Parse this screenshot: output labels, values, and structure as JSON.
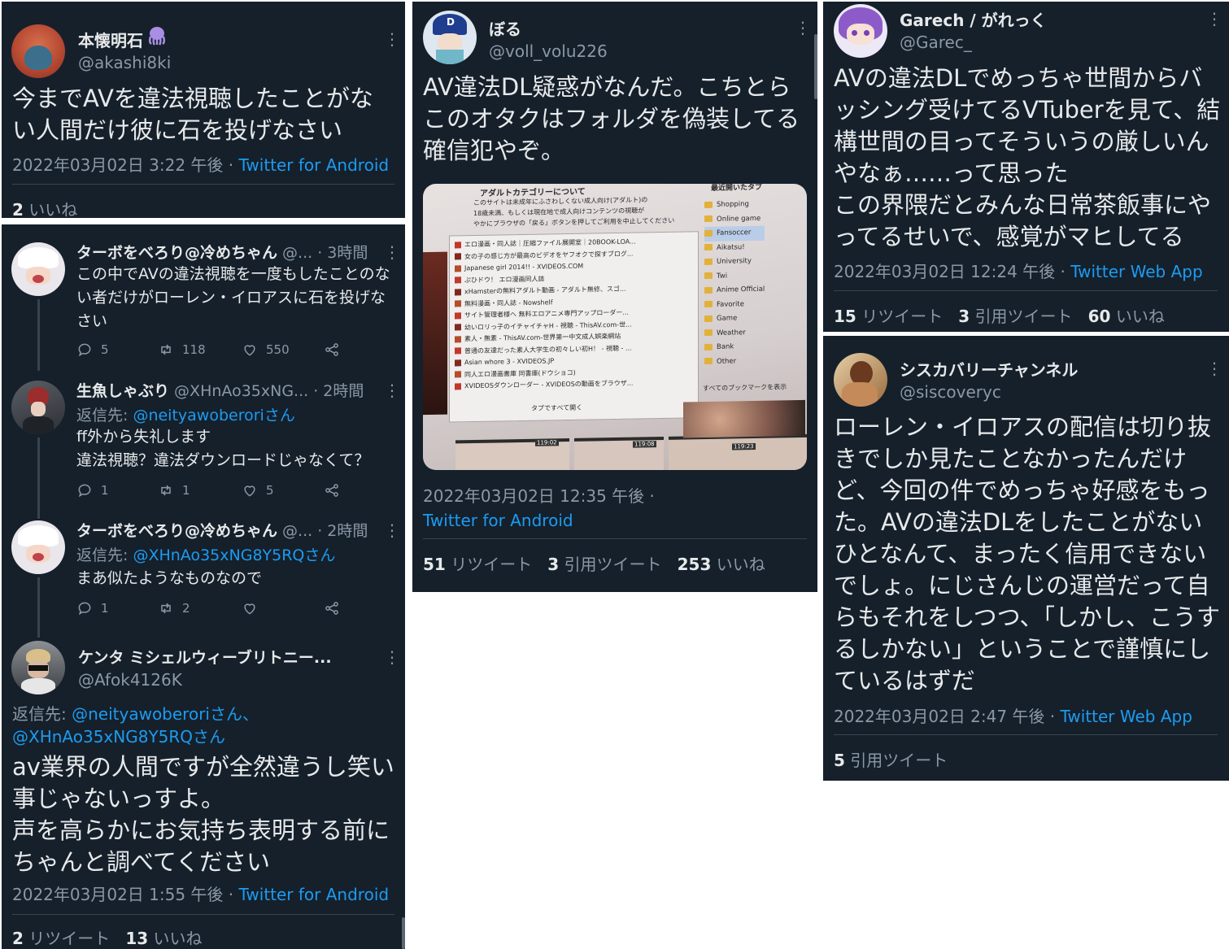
{
  "tweet1": {
    "name": "本懐明石",
    "handle": "@akashi8ki",
    "text": "今までAVを違法視聴したことがない人間だけ彼に石を投げなさい",
    "time": "2022年03月02日 3:22 午後 · ",
    "source": "Twitter for Android",
    "likes_count": "2",
    "likes_label": " いいね"
  },
  "replies": {
    "r1": {
      "name": "ターボをべろり@冷めちゃん",
      "handle_time": " @... · 3時間",
      "text": "この中でAVの違法視聴を一度もしたことのない者だけがローレン・イロアスに石を投げなさい",
      "reply_count": "5",
      "retweet_count": "118",
      "like_count": "550"
    },
    "r2": {
      "name": "生魚しゃぶり",
      "handle_time": " @XHnAo35xNG... · 2時間",
      "reply_to_label": "返信先: ",
      "reply_to": "@neityawoberoriさん",
      "text_line1": "ff外から失礼します",
      "text_line2": "違法視聴？違法ダウンロードじゃなくて？",
      "reply_count": "1",
      "retweet_count": "1",
      "like_count": "5"
    },
    "r3": {
      "name": "ターボをべろり@冷めちゃん",
      "handle_time": " @... · 2時間",
      "reply_to_label": "返信先: ",
      "reply_to": "@XHnAo35xNG8Y5RQさん",
      "text": "まあ似たようなものなので",
      "reply_count": "1",
      "retweet_count": "2"
    }
  },
  "tweet2": {
    "name": "ケンタ ミシェルウィーブリトニー...",
    "handle": "@Afok4126K",
    "reply_to_label": "返信先: ",
    "reply_to_line1": "@neityawoberoriさん、",
    "reply_to_line2": "@XHnAo35xNG8Y5RQさん",
    "text": "av業界の人間ですが全然違うし笑い事じゃないっすよ。\n声を高らかにお気持ち表明する前にちゃんと調べてください",
    "time": "2022年03月02日 1:55 午後 · ",
    "source": "Twitter for Android",
    "retweets_count": "2",
    "retweets_label": " リツイート",
    "likes_count": "13",
    "likes_label": " いいね"
  },
  "tweet3": {
    "name": "ぼる",
    "handle": "@voll_volu226",
    "text": "AV違法DL疑惑がなんだ。こちとらこのオタクはフォルダを偽装してる確信犯やぞ。",
    "time": "2022年03月02日 12:35 午後 ·",
    "source": "Twitter for Android",
    "retweets_count": "51",
    "retweets_label": " リツイート",
    "quotes_count": "3",
    "quotes_label": " 引用ツイート",
    "likes_count": "253",
    "likes_label": " いいね",
    "photo": {
      "header": "アダルトカテゴリーについて",
      "warning1": "このサイトは未成年にふさわしくない成人向け(アダルト)の",
      "warning2": "18歳未満、もしくは現在地で成人向けコンテンツの視聴が",
      "warning3": "やかにブラウザの「戻る」ボタンを押してご利用を中止してください",
      "side_head": "最近開いたタブ",
      "bookmarks": [
        "エロ漫画・同人誌｜圧縮ファイル展開室｜20BOOK-LOA...",
        "女の子の感じ方が最高のビデオをヤフオクで探すブログ...",
        "Japanese girl 2014!! - XVIDEOS.COM",
        "ぷひドウ！ エロ漫画同人誌",
        "xHamsterの無料アダルト動画 - アダルト無修、スゴ...",
        "無料漫画・同人誌 - Nowshelf",
        "サイト管理者様へ 無料エロアニメ専門アップローダー...",
        "幼いロリっ子のイチャイチャH - 視聴 - ThisAV.com-世...",
        "素人・無素 - ThisAV.com-世界第一中文成人娯楽網站",
        "普通の友達だった素人大学生の初々しい初H！ - 視聴 - ...",
        "Asian whore 3 - XVIDEOS.JP",
        "同人エロ漫画書庫 同書庫(ドウショコ)",
        "XVIDEOSダウンローダー - XVIDEOSの動画をブラウザ..."
      ],
      "folders": [
        "Shopping",
        "Online game",
        "Fansoccer",
        "Aikatsu!",
        "University",
        "Twi",
        "Anime Official",
        "Favorite",
        "Game",
        "Weather",
        "Bank",
        "Other"
      ],
      "show_all": "すべてのブックマークを表示",
      "open_tabs": "タブですべて開く",
      "thumb_times": [
        "119:02",
        "119:08",
        "119:23"
      ]
    }
  },
  "tweet4": {
    "name": "Garech / がれっく",
    "handle": "@Garec_",
    "text": "AVの違法DLでめっちゃ世間からバッシング受けてるVTuberを見て、結構世間の目ってそういうの厳しいんやなぁ……って思った\nこの界隈だとみんな日常茶飯事にやってるせいで、感覚がマヒしてる",
    "time": "2022年03月02日 12:24 午後 · ",
    "source": "Twitter Web App",
    "retweets_count": "15",
    "retweets_label": " リツイート",
    "quotes_count": "3",
    "quotes_label": " 引用ツイート",
    "likes_count": "60",
    "likes_label": " いいね"
  },
  "tweet5": {
    "name": "シスカバリーチャンネル",
    "handle": "@siscoveryc",
    "text": "ローレン・イロアスの配信は切り抜きでしか見たことなかったんだけど、今回の件でめっちゃ好感をもった。AVの違法DLをしたことがないひとなんて、まったく信用できないでしょ。にじさんじの運営だって自らもそれをしつつ、「しかし、こうするしかない」ということで謹慎にしているはずだ",
    "time": "2022年03月02日 2:47 午後 · ",
    "source": "Twitter Web App",
    "quotes_count": "5",
    "quotes_label": " 引用ツイート"
  },
  "icons": {
    "more": "more-dots-icon",
    "reply": "reply-bubble-icon",
    "retweet": "retweet-icon",
    "like": "heart-icon",
    "share": "share-icon",
    "octopus": "octopus-emoji"
  },
  "colors": {
    "background": "#15202b",
    "text": "#e7e9ea",
    "secondary": "#8b98a5",
    "link": "#1d9bf0",
    "divider": "#38444d"
  }
}
